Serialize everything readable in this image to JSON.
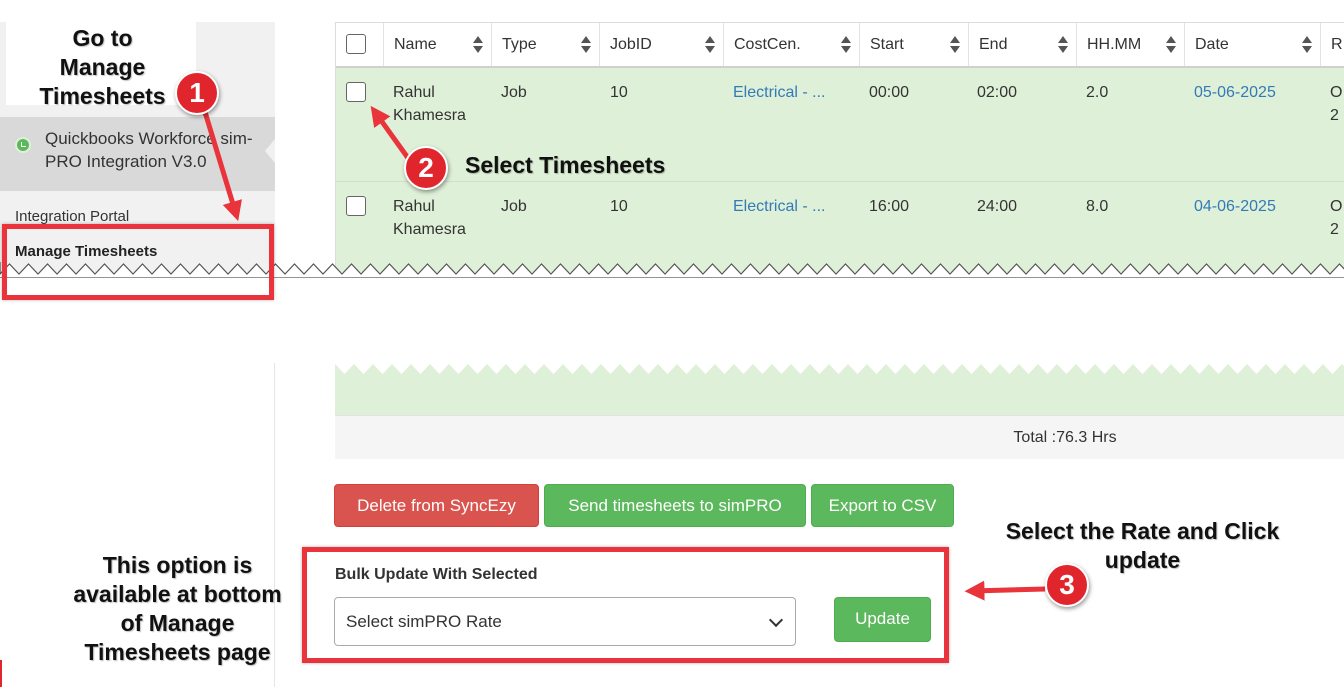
{
  "sidebar": {
    "app_name": "Quickbooks Workforce sim-PRO Integration V3.0",
    "items": [
      {
        "label": "Integration Portal"
      },
      {
        "label": "Manage Timesheets"
      }
    ]
  },
  "table": {
    "columns": [
      "Name",
      "Type",
      "JobID",
      "CostCen.",
      "Start",
      "End",
      "HH.MM",
      "Date",
      "R"
    ],
    "rows": [
      {
        "name_first": "Rahul",
        "name_last": "Khamesra",
        "type": "Job",
        "job_id": "10",
        "cost_center": "Electrical - ...",
        "start": "00:00",
        "end": "02:00",
        "hhmm": "2.0",
        "date": "05-06-2025",
        "extra_1": "O",
        "extra_2": "2"
      },
      {
        "name_first": "Rahul",
        "name_last": "Khamesra",
        "type": "Job",
        "job_id": "10",
        "cost_center": "Electrical - ...",
        "start": "16:00",
        "end": "24:00",
        "hhmm": "8.0",
        "date": "04-06-2025",
        "extra_1": "O",
        "extra_2": "2"
      }
    ],
    "row_color": "#dff0d8",
    "link_color": "#337ab7",
    "total": "Total :76.3 Hrs"
  },
  "actions": {
    "delete_label": "Delete from SyncEzy",
    "send_label": "Send timesheets to simPRO",
    "export_label": "Export to CSV"
  },
  "bulk": {
    "label": "Bulk Update With Selected",
    "select_value": "Select simPRO Rate",
    "update_label": "Update"
  },
  "annotations": {
    "step1_text": "Go to Manage Timesheets",
    "step1_line1": "Go to",
    "step1_line2": "Manage",
    "step1_line3": "Timesheets",
    "step1_badge": "1",
    "step2_text": "Select Timesheets",
    "step2_badge": "2",
    "step3_line1": "Select the Rate and Click",
    "step3_line2": "update",
    "step3_badge": "3",
    "bottom_line1": "This option is",
    "bottom_line2": "available at bottom",
    "bottom_line3": "of Manage",
    "bottom_line4": "Timesheets page",
    "annotation_color": "#e8343a"
  }
}
